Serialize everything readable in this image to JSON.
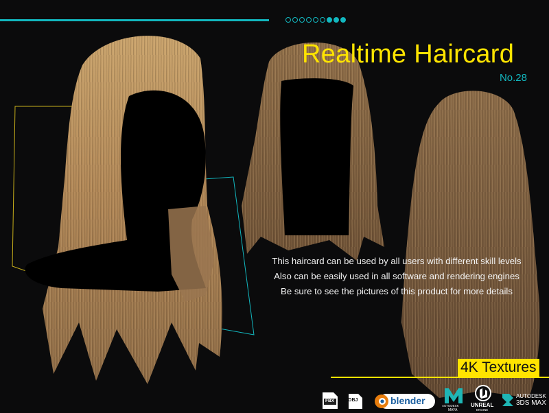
{
  "progress": {
    "total": 9,
    "active_from": 6
  },
  "header": {
    "title": "Realtime Haircard",
    "number": "No.28"
  },
  "description": [
    "This haircard can be used by all users with different skill levels",
    "Also can be easily used in all software and rendering engines",
    "Be sure to see the pictures of this product for more details"
  ],
  "badge": "4K Textures",
  "logos": {
    "fbx": "FBX",
    "obj": "OBJ",
    "blender": "blender",
    "maya_line1": "AUTODESK",
    "maya_line2": "MAYA",
    "unreal_line1": "UNREAL",
    "unreal_line2": "ENGINE",
    "max_line1": "AUTODESK",
    "max_line2": "3DS MAX"
  },
  "colors": {
    "accent_cyan": "#12b7bf",
    "accent_yellow": "#ffe400",
    "hair_light": "#b88f5a",
    "hair_dark": "#6b4f33"
  }
}
